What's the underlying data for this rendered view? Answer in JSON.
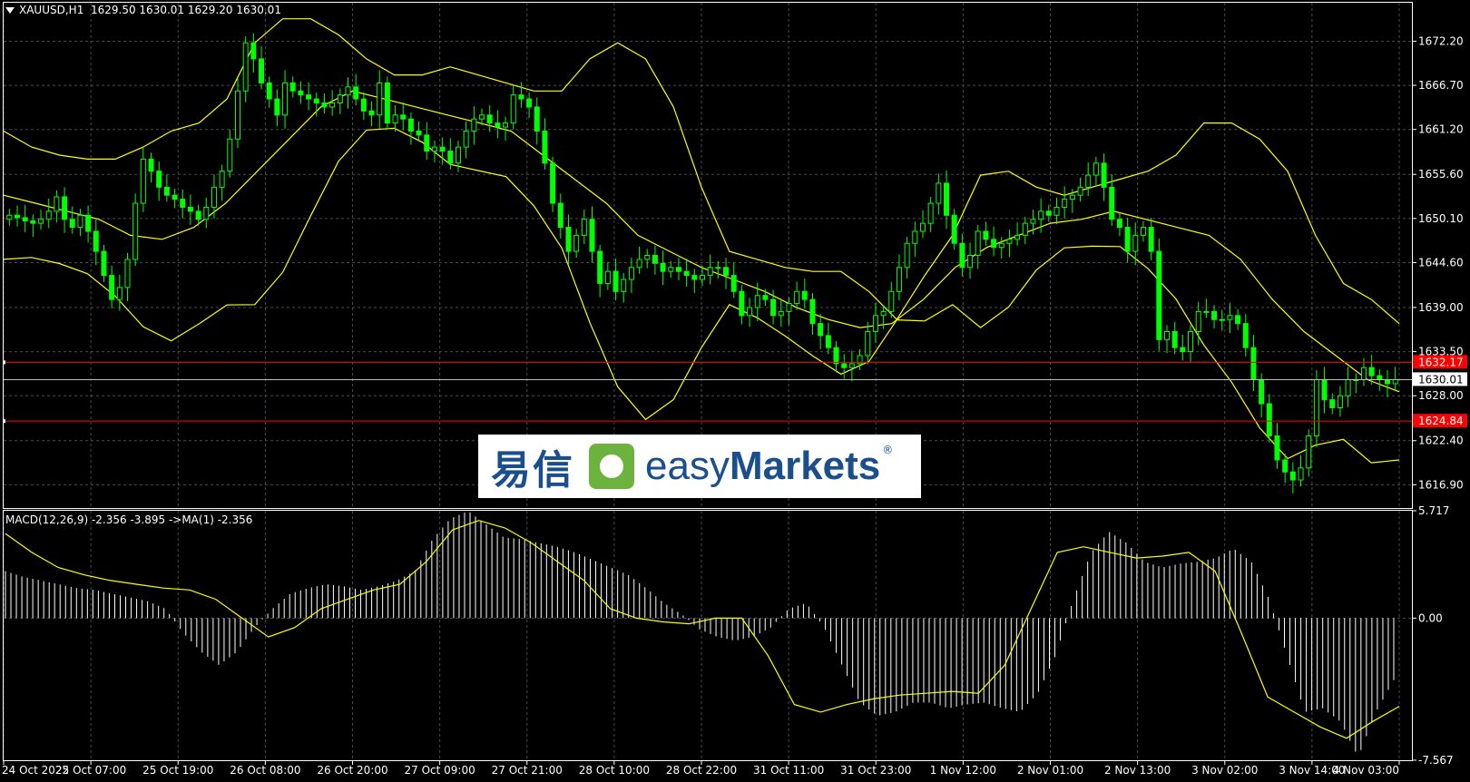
{
  "header": {
    "symbol": "XAUUSD,H1",
    "open": "1629.50",
    "high": "1630.01",
    "low": "1629.20",
    "close": "1630.01"
  },
  "macd_header": "MACD(12,26,9) -2.356 -3.895  ->MA(1) -2.356",
  "logo": {
    "cn": "易信",
    "en_light": "easy",
    "en_bold": "Markets",
    "reg": "®"
  },
  "colors": {
    "background": "#000000",
    "grid": "#4a4a4a",
    "candle": "#00ff00",
    "bands": "#ffff00",
    "hline": "#ff0000",
    "current": "#c0c0c0",
    "macd_hist": "#ffffff"
  },
  "chart_data": [
    {
      "type": "candlestick",
      "symbol": "XAUUSD",
      "timeframe": "H1",
      "ylim": [
        1614.0,
        1677.0
      ],
      "y_ticks": [
        "1672.20",
        "1666.70",
        "1661.20",
        "1655.60",
        "1650.10",
        "1644.60",
        "1639.00",
        "1633.50",
        "1628.00",
        "1622.40",
        "1616.90"
      ],
      "x_ticks": [
        "24 Oct 2022",
        "25 Oct 07:00",
        "25 Oct 19:00",
        "26 Oct 08:00",
        "26 Oct 20:00",
        "27 Oct 09:00",
        "27 Oct 21:00",
        "28 Oct 10:00",
        "28 Oct 22:00",
        "31 Oct 11:00",
        "31 Oct 23:00",
        "1 Nov 12:00",
        "2 Nov 01:00",
        "2 Nov 13:00",
        "3 Nov 02:00",
        "3 Nov 14:00",
        "4 Nov 03:00"
      ],
      "close_series": [
        1650.5,
        1650.2,
        1649.8,
        1649.5,
        1650.0,
        1651.0,
        1652.8,
        1650.0,
        1649.0,
        1650.5,
        1648.5,
        1646.0,
        1643.0,
        1640.0,
        1641.5,
        1645.0,
        1652.0,
        1657.5,
        1656.0,
        1654.0,
        1653.0,
        1652.5,
        1651.5,
        1651.0,
        1650.0,
        1651.5,
        1654.0,
        1656.0,
        1660.0,
        1666.0,
        1672.0,
        1670.0,
        1667.0,
        1665.0,
        1663.0,
        1667.0,
        1666.0,
        1665.5,
        1665.0,
        1664.5,
        1664.0,
        1664.5,
        1665.5,
        1666.5,
        1665.0,
        1663.5,
        1663.0,
        1667.0,
        1662.0,
        1663.0,
        1662.5,
        1661.0,
        1660.5,
        1658.5,
        1659.0,
        1658.5,
        1657.0,
        1659.0,
        1661.0,
        1662.5,
        1663.0,
        1662.0,
        1661.5,
        1662.0,
        1665.5,
        1665.0,
        1664.0,
        1661.0,
        1657.0,
        1652.0,
        1649.0,
        1646.0,
        1648.0,
        1650.0,
        1646.0,
        1642.0,
        1643.5,
        1641.0,
        1642.5,
        1644.0,
        1645.0,
        1645.5,
        1644.5,
        1643.5,
        1644.0,
        1643.5,
        1643.0,
        1642.5,
        1643.0,
        1644.0,
        1644.0,
        1643.0,
        1641.0,
        1638.0,
        1639.0,
        1640.5,
        1640.0,
        1638.0,
        1638.5,
        1639.5,
        1641.0,
        1640.0,
        1637.0,
        1635.5,
        1634.0,
        1632.0,
        1631.5,
        1632.0,
        1633.0,
        1636.0,
        1638.0,
        1638.5,
        1641.0,
        1644.0,
        1647.0,
        1648.5,
        1649.5,
        1652.0,
        1654.5,
        1650.5,
        1647.0,
        1644.0,
        1645.5,
        1648.5,
        1647.5,
        1646.5,
        1647.0,
        1647.5,
        1648.0,
        1649.5,
        1650.0,
        1651.0,
        1650.5,
        1651.5,
        1652.5,
        1653.0,
        1654.0,
        1655.5,
        1657.0,
        1654.0,
        1650.0,
        1649.0,
        1646.0,
        1648.0,
        1649.0,
        1646.0,
        1635.0,
        1636.0,
        1634.0,
        1633.5,
        1636.0,
        1638.5,
        1638.5,
        1637.5,
        1637.5,
        1638.0,
        1637.0,
        1634.0,
        1630.0,
        1627.0,
        1623.0,
        1620.0,
        1618.5,
        1617.5,
        1619.0,
        1623.0,
        1630.0,
        1627.5,
        1626.5,
        1628.0,
        1630.0,
        1630.0,
        1631.5,
        1630.5,
        1630.0,
        1629.5,
        1630.01
      ],
      "bollinger": {
        "upper": [
          1661.0,
          1659.0,
          1658.0,
          1657.5,
          1657.5,
          1659.0,
          1661.0,
          1662.0,
          1665.0,
          1672.0,
          1675.0,
          1675.0,
          1673.0,
          1670.0,
          1668.0,
          1668.0,
          1669.0,
          1668.0,
          1667.0,
          1666.0,
          1666.0,
          1670.0,
          1672.0,
          1670.0,
          1664.0,
          1654.0,
          1646.0,
          1645.0,
          1644.0,
          1643.5,
          1643.5,
          1641.0,
          1637.5,
          1643.0,
          1648.0,
          1655.5,
          1656.0,
          1654.0,
          1653.0,
          1654.0,
          1655.0,
          1656.0,
          1658.0,
          1662.0,
          1662.0,
          1660.0,
          1656.0,
          1648.0,
          1642.0,
          1640.0,
          1637.0
        ],
        "middle": [
          1653.0,
          1652.0,
          1651.0,
          1650.0,
          1648.0,
          1647.5,
          1649.0,
          1652.0,
          1656.0,
          1660.0,
          1664.0,
          1666.0,
          1665.0,
          1664.0,
          1663.0,
          1662.0,
          1661.0,
          1658.0,
          1655.0,
          1652.0,
          1648.0,
          1646.0,
          1644.0,
          1642.5,
          1641.0,
          1639.0,
          1637.5,
          1636.5,
          1637.0,
          1640.0,
          1644.0,
          1646.5,
          1648.0,
          1649.5,
          1650.0,
          1651.0,
          1650.0,
          1649.0,
          1648.0,
          1645.0,
          1640.0,
          1636.0,
          1633.0,
          1630.0,
          1628.5
        ]
      },
      "hlines": [
        {
          "label": "1632.17",
          "value": 1632.17
        },
        {
          "label": "1624.84",
          "value": 1624.84
        }
      ],
      "current_price": {
        "label": "1630.01",
        "value": 1630.01
      }
    },
    {
      "type": "bar",
      "name": "MACD(12,26,9)",
      "ylim": [
        -7.567,
        5.717
      ],
      "y_ticks": [
        "5.717",
        "0.00",
        "-7.567"
      ],
      "macd": [
        2.5,
        2.2,
        2.0,
        1.8,
        1.6,
        1.5,
        1.3,
        1.1,
        0.9,
        0.5,
        -0.8,
        -1.8,
        -2.5,
        -1.8,
        -0.5,
        0.5,
        1.3,
        1.6,
        1.8,
        1.7,
        1.5,
        1.7,
        2.0,
        2.5,
        4.2,
        5.3,
        5.7,
        5.0,
        4.3,
        4.2,
        4.0,
        3.8,
        3.5,
        3.1,
        2.7,
        2.3,
        1.6,
        0.8,
        0.2,
        -0.6,
        -1.0,
        -1.2,
        -1.0,
        -0.5,
        0.5,
        0.8,
        -0.5,
        -2.5,
        -4.5,
        -5.2,
        -5.0,
        -4.5,
        -4.5,
        -4.8,
        -4.6,
        -4.5,
        -4.8,
        -5.0,
        -4.0,
        -2.0,
        1.0,
        3.5,
        4.6,
        4.0,
        3.0,
        2.7,
        2.9,
        3.0,
        3.2,
        3.7,
        3.0,
        1.0,
        -2.0,
        -5.0,
        -4.8,
        -5.5,
        -7.4,
        -5.0,
        -3.3
      ],
      "signal": [
        4.5,
        3.5,
        2.7,
        2.3,
        2.0,
        1.8,
        1.6,
        1.5,
        1.0,
        0.0,
        -1.0,
        -0.5,
        0.5,
        1.0,
        1.5,
        1.8,
        3.0,
        4.7,
        5.2,
        4.8,
        4.0,
        3.0,
        2.0,
        0.5,
        0.0,
        -0.2,
        -0.3,
        0.0,
        0.0,
        -2.0,
        -4.6,
        -5.0,
        -4.6,
        -4.3,
        -4.1,
        -4.0,
        -3.9,
        -4.0,
        -2.5,
        0.5,
        3.5,
        3.8,
        3.5,
        3.2,
        3.3,
        3.5,
        2.5,
        -0.8,
        -4.2,
        -5.0,
        -5.8,
        -6.4,
        -5.5,
        -4.7
      ]
    }
  ]
}
